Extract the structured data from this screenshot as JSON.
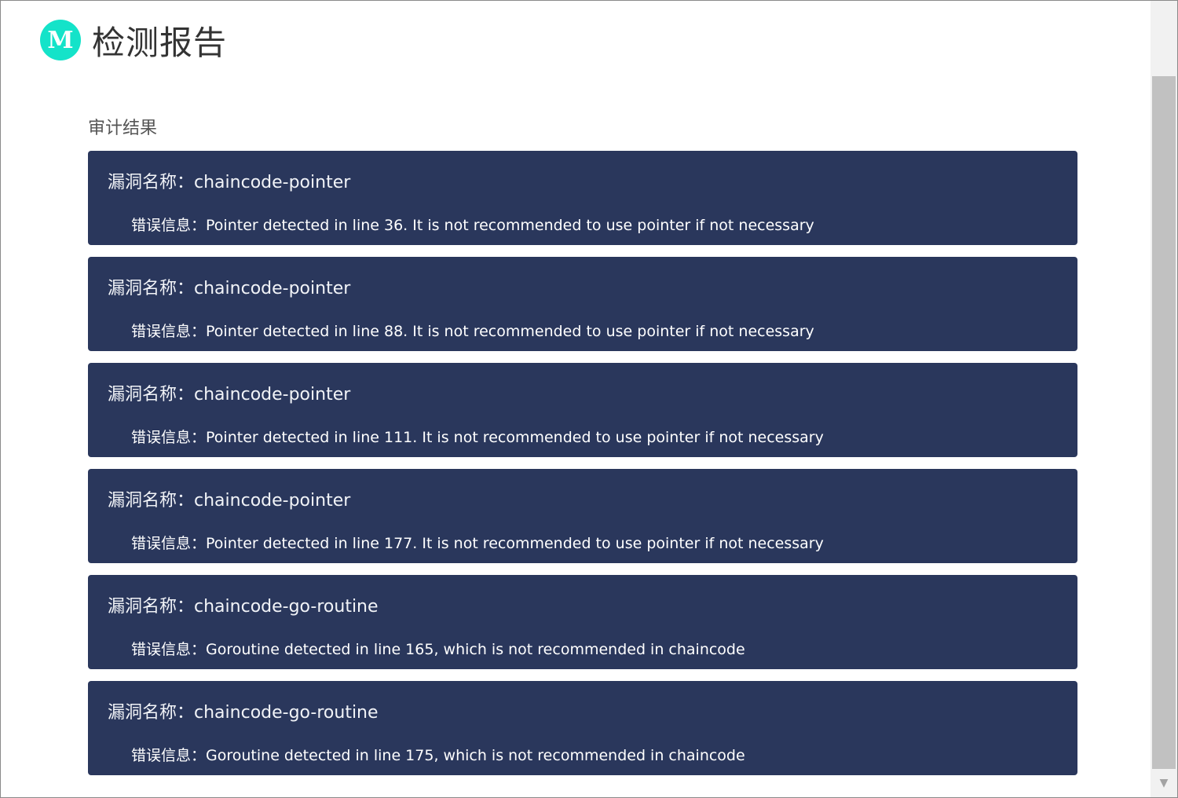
{
  "header": {
    "logo_letter": "M",
    "title": "检测报告"
  },
  "section": {
    "title": "审计结果"
  },
  "labels": {
    "vuln_name": "漏洞名称：",
    "error_info": "错误信息："
  },
  "results": [
    {
      "name": "chaincode-pointer",
      "message": "Pointer detected in line 36. It is not recommended to use pointer if not necessary"
    },
    {
      "name": "chaincode-pointer",
      "message": "Pointer detected in line 88. It is not recommended to use pointer if not necessary"
    },
    {
      "name": "chaincode-pointer",
      "message": "Pointer detected in line 111. It is not recommended to use pointer if not necessary"
    },
    {
      "name": "chaincode-pointer",
      "message": "Pointer detected in line 177. It is not recommended to use pointer if not necessary"
    },
    {
      "name": "chaincode-go-routine",
      "message": "Goroutine detected in line 165, which is not recommended in chaincode"
    },
    {
      "name": "chaincode-go-routine",
      "message": "Goroutine detected in line 175, which is not recommended in chaincode"
    }
  ],
  "colors": {
    "logo": "#14e3c9",
    "card_background": "#2a375c"
  },
  "scrollbar": {
    "arrow_icon": "triangle-down"
  }
}
